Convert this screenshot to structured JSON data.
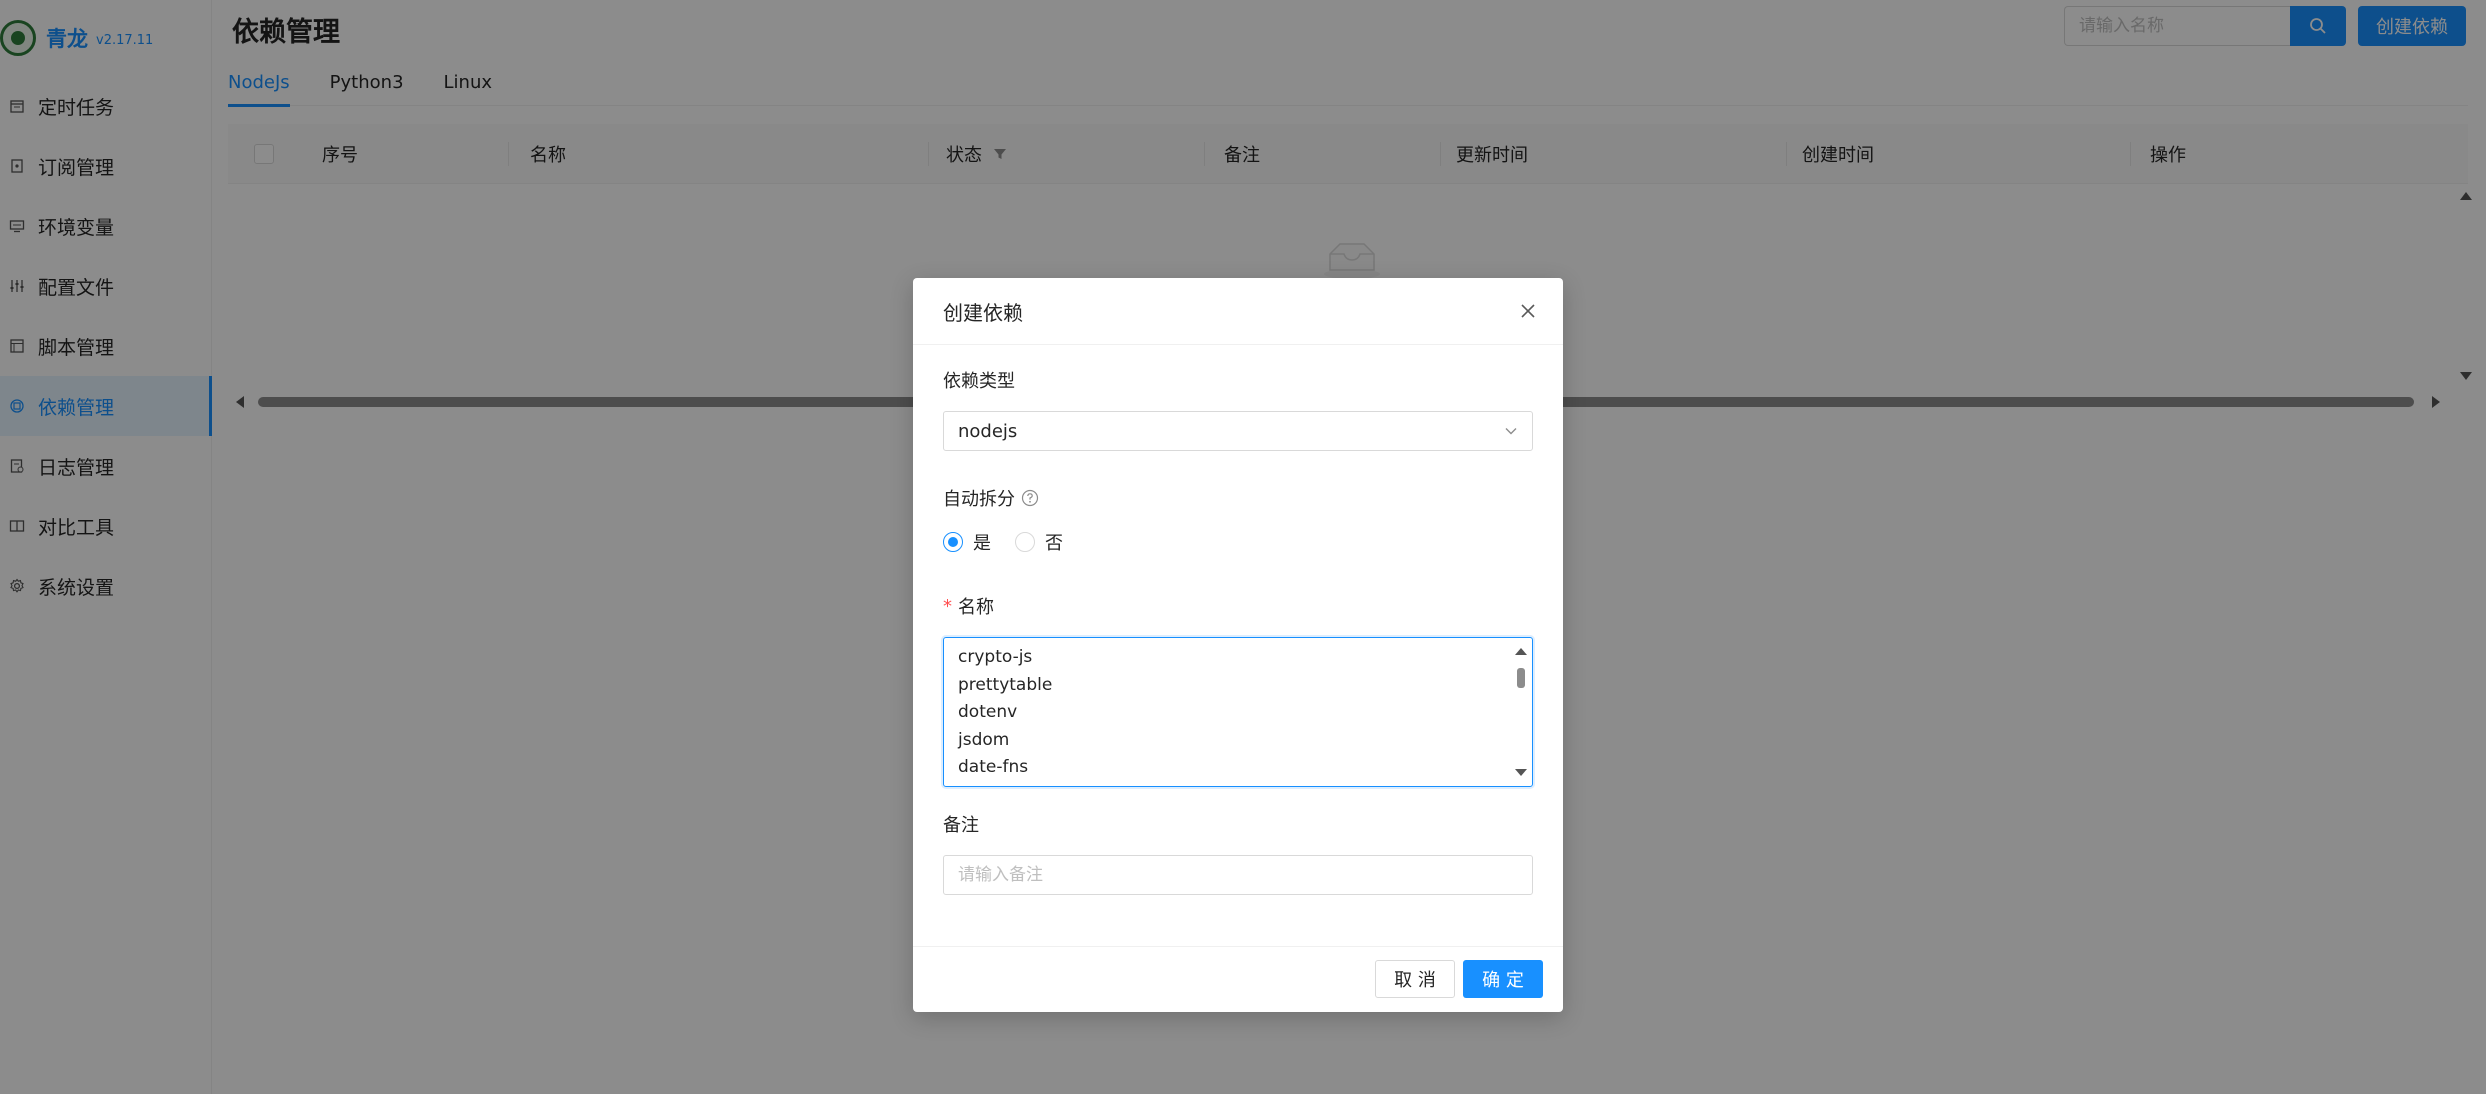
{
  "brand": {
    "name": "青龙",
    "version": "v2.17.11"
  },
  "sidebar": {
    "items": [
      {
        "label": "定时任务",
        "icon": "calendar-icon",
        "active": false
      },
      {
        "label": "订阅管理",
        "icon": "subscription-icon",
        "active": false
      },
      {
        "label": "环境变量",
        "icon": "monitor-icon",
        "active": false
      },
      {
        "label": "配置文件",
        "icon": "sliders-icon",
        "active": false
      },
      {
        "label": "脚本管理",
        "icon": "code-file-icon",
        "active": false
      },
      {
        "label": "依赖管理",
        "icon": "dependency-icon",
        "active": true
      },
      {
        "label": "日志管理",
        "icon": "log-icon",
        "active": false
      },
      {
        "label": "对比工具",
        "icon": "diff-icon",
        "active": false
      },
      {
        "label": "系统设置",
        "icon": "gear-icon",
        "active": false
      }
    ]
  },
  "header": {
    "title": "依赖管理",
    "search_placeholder": "请输入名称",
    "create_label": "创建依赖"
  },
  "tabs": [
    {
      "label": "NodeJs",
      "active": true
    },
    {
      "label": "Python3",
      "active": false
    },
    {
      "label": "Linux",
      "active": false
    }
  ],
  "table": {
    "columns": [
      "序号",
      "名称",
      "状态",
      "备注",
      "更新时间",
      "创建时间",
      "操作"
    ]
  },
  "modal": {
    "title": "创建依赖",
    "type_label": "依赖类型",
    "type_value": "nodejs",
    "split_label": "自动拆分",
    "split_options": [
      {
        "label": "是",
        "checked": true
      },
      {
        "label": "否",
        "checked": false
      }
    ],
    "name_label": "名称",
    "name_lines": [
      "crypto-js",
      "prettytable",
      "dotenv",
      "jsdom",
      "date-fns"
    ],
    "remark_label": "备注",
    "remark_placeholder": "请输入备注",
    "cancel_label": "取 消",
    "ok_label": "确 定"
  },
  "colors": {
    "primary": "#1890ff",
    "brand_green": "#2f7d3b",
    "required": "#ff4d4f"
  }
}
